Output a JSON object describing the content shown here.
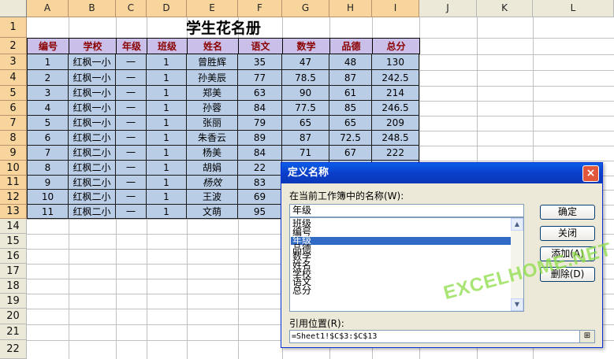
{
  "columns": [
    "A",
    "B",
    "C",
    "D",
    "E",
    "F",
    "G",
    "H",
    "I",
    "J",
    "K",
    "L"
  ],
  "rows": [
    "1",
    "2",
    "3",
    "4",
    "5",
    "6",
    "7",
    "8",
    "9",
    "10",
    "11",
    "12",
    "13",
    "14",
    "15",
    "16",
    "17",
    "18",
    "19",
    "20",
    "21",
    "22"
  ],
  "sheet_title": "学生花名册",
  "headers": [
    "编号",
    "学校",
    "年级",
    "班级",
    "姓名",
    "语文",
    "数学",
    "品德",
    "总分"
  ],
  "data": [
    [
      "1",
      "红枫一小",
      "一",
      "1",
      "曾胜辉",
      "35",
      "47",
      "48",
      "130"
    ],
    [
      "2",
      "红枫一小",
      "一",
      "1",
      "孙美辰",
      "77",
      "78.5",
      "87",
      "242.5"
    ],
    [
      "3",
      "红枫一小",
      "一",
      "1",
      "郑美",
      "63",
      "90",
      "61",
      "214"
    ],
    [
      "4",
      "红枫一小",
      "一",
      "1",
      "孙蓉",
      "84",
      "77.5",
      "85",
      "246.5"
    ],
    [
      "5",
      "红枫一小",
      "一",
      "1",
      "张丽",
      "79",
      "65",
      "65",
      "209"
    ],
    [
      "6",
      "红枫二小",
      "一",
      "1",
      "朱香云",
      "89",
      "87",
      "72.5",
      "248.5"
    ],
    [
      "7",
      "红枫二小",
      "一",
      "1",
      "杨美",
      "84",
      "71",
      "67",
      "222"
    ],
    [
      "8",
      "红枫二小",
      "一",
      "1",
      "胡娟",
      "22",
      "",
      "",
      ""
    ],
    [
      "9",
      "红枫二小",
      "一",
      "1",
      "杨效",
      "83",
      "",
      "",
      ""
    ],
    [
      "10",
      "红枫二小",
      "一",
      "1",
      "王波",
      "69",
      "",
      "",
      ""
    ],
    [
      "11",
      "红枫二小",
      "一",
      "1",
      "文萌",
      "95",
      "",
      "",
      ""
    ]
  ],
  "dialog": {
    "title": "定义名称",
    "close": "×",
    "names_label": "在当前工作簿中的名称(W):",
    "name_value": "年级",
    "list": [
      "班级",
      "编号",
      "年级",
      "品德",
      "数学",
      "姓名",
      "学校",
      "语文",
      "总分"
    ],
    "selected_index": 2,
    "ok": "确定",
    "close_btn": "关闭",
    "add": "添加(A)",
    "delete": "删除(D)",
    "ref_label": "引用位置(R):",
    "ref_value": "=Sheet1!$C$3:$C$13",
    "ref_btn": "⊞"
  },
  "watermark": "EXCELHOME.NET"
}
